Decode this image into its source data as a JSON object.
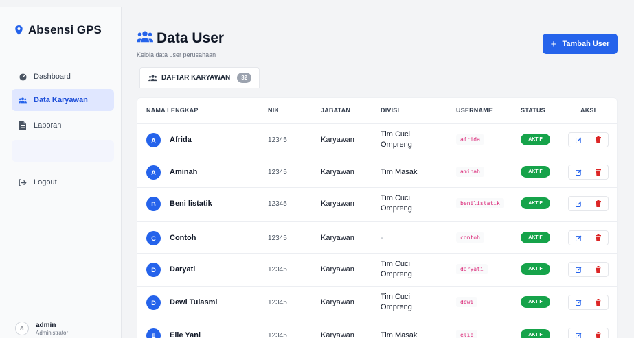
{
  "colors": {
    "primary": "#2563eb",
    "active_status": "#16a34a",
    "username_text": "#db2777",
    "delete_icon": "#dc2626"
  },
  "sidebar": {
    "brand": "Absensi GPS",
    "items": [
      {
        "label": "Dashboard",
        "icon": "dashboard-icon",
        "active": false
      },
      {
        "label": "Data Karyawan",
        "icon": "users-icon",
        "active": true
      },
      {
        "label": "Laporan",
        "icon": "file-icon",
        "active": false
      },
      {
        "label": "Logout",
        "icon": "logout-icon",
        "active": false
      }
    ],
    "user": {
      "avatar": "a",
      "name": "admin",
      "role": "Administrator"
    }
  },
  "header": {
    "title": "Data User",
    "subtitle": "Kelola data user perusahaan",
    "add_button": "Tambah User"
  },
  "tab": {
    "label": "DAFTAR KARYAWAN",
    "count": "32"
  },
  "table": {
    "headers": [
      "NAMA LENGKAP",
      "NIK",
      "JABATAN",
      "DIVISI",
      "USERNAME",
      "STATUS",
      "AKSI"
    ],
    "rows": [
      {
        "initial": "A",
        "name": "Afrida",
        "nik": "12345",
        "jabatan": "Karyawan",
        "divisi": [
          "Tim Cuci",
          "Ompreng"
        ],
        "username": "afrida",
        "status": "AKTIF"
      },
      {
        "initial": "A",
        "name": "Aminah",
        "nik": "12345",
        "jabatan": "Karyawan",
        "divisi": [
          "Tim Masak"
        ],
        "username": "aminah",
        "status": "AKTIF"
      },
      {
        "initial": "B",
        "name": "Beni listatik",
        "nik": "12345",
        "jabatan": "Karyawan",
        "divisi": [
          "Tim Cuci",
          "Ompreng"
        ],
        "username": "benilistatik",
        "status": "AKTIF"
      },
      {
        "initial": "C",
        "name": "Contoh",
        "nik": "12345",
        "jabatan": "Karyawan",
        "divisi": [
          "-"
        ],
        "username": "contoh",
        "status": "AKTIF"
      },
      {
        "initial": "D",
        "name": "Daryati",
        "nik": "12345",
        "jabatan": "Karyawan",
        "divisi": [
          "Tim Cuci",
          "Ompreng"
        ],
        "username": "daryati",
        "status": "AKTIF"
      },
      {
        "initial": "D",
        "name": "Dewi Tulasmi",
        "nik": "12345",
        "jabatan": "Karyawan",
        "divisi": [
          "Tim Cuci",
          "Ompreng"
        ],
        "username": "dewi",
        "status": "AKTIF"
      },
      {
        "initial": "E",
        "name": "Elie Yani",
        "nik": "12345",
        "jabatan": "Karyawan",
        "divisi": [
          "Tim Masak"
        ],
        "username": "elie",
        "status": "AKTIF"
      }
    ]
  }
}
